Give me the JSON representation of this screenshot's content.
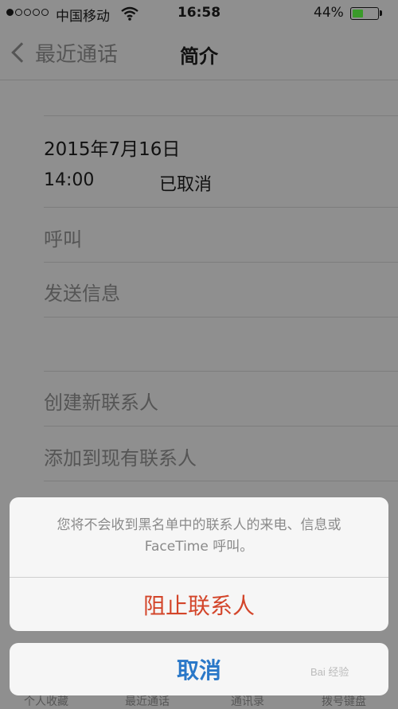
{
  "status_bar": {
    "carrier": "中国移动",
    "signal_bars_filled": 1,
    "signal_bars_total": 5,
    "time": "16:58",
    "battery_percent_text": "44%",
    "battery_level": 0.44,
    "battery_color": "#3a9a2a"
  },
  "nav": {
    "back_label": "最近通话",
    "title": "简介"
  },
  "call": {
    "date": "2015年7月16日",
    "time": "14:00",
    "status": "已取消"
  },
  "actions": {
    "call": "呼叫",
    "message": "发送信息",
    "create_contact": "创建新联系人",
    "add_to_existing": "添加到现有联系人"
  },
  "action_sheet": {
    "message": "您将不会收到黑名单中的联系人的来电、信息或 FaceTime 呼叫。",
    "block_label": "阻止联系人",
    "cancel_label": "取消",
    "block_color": "#d3452a",
    "cancel_color": "#2a78c8"
  },
  "tabbar": {
    "items": [
      "个人收藏",
      "最近通话",
      "通讯录",
      "拨号键盘"
    ]
  },
  "watermark": "Bai 经验"
}
